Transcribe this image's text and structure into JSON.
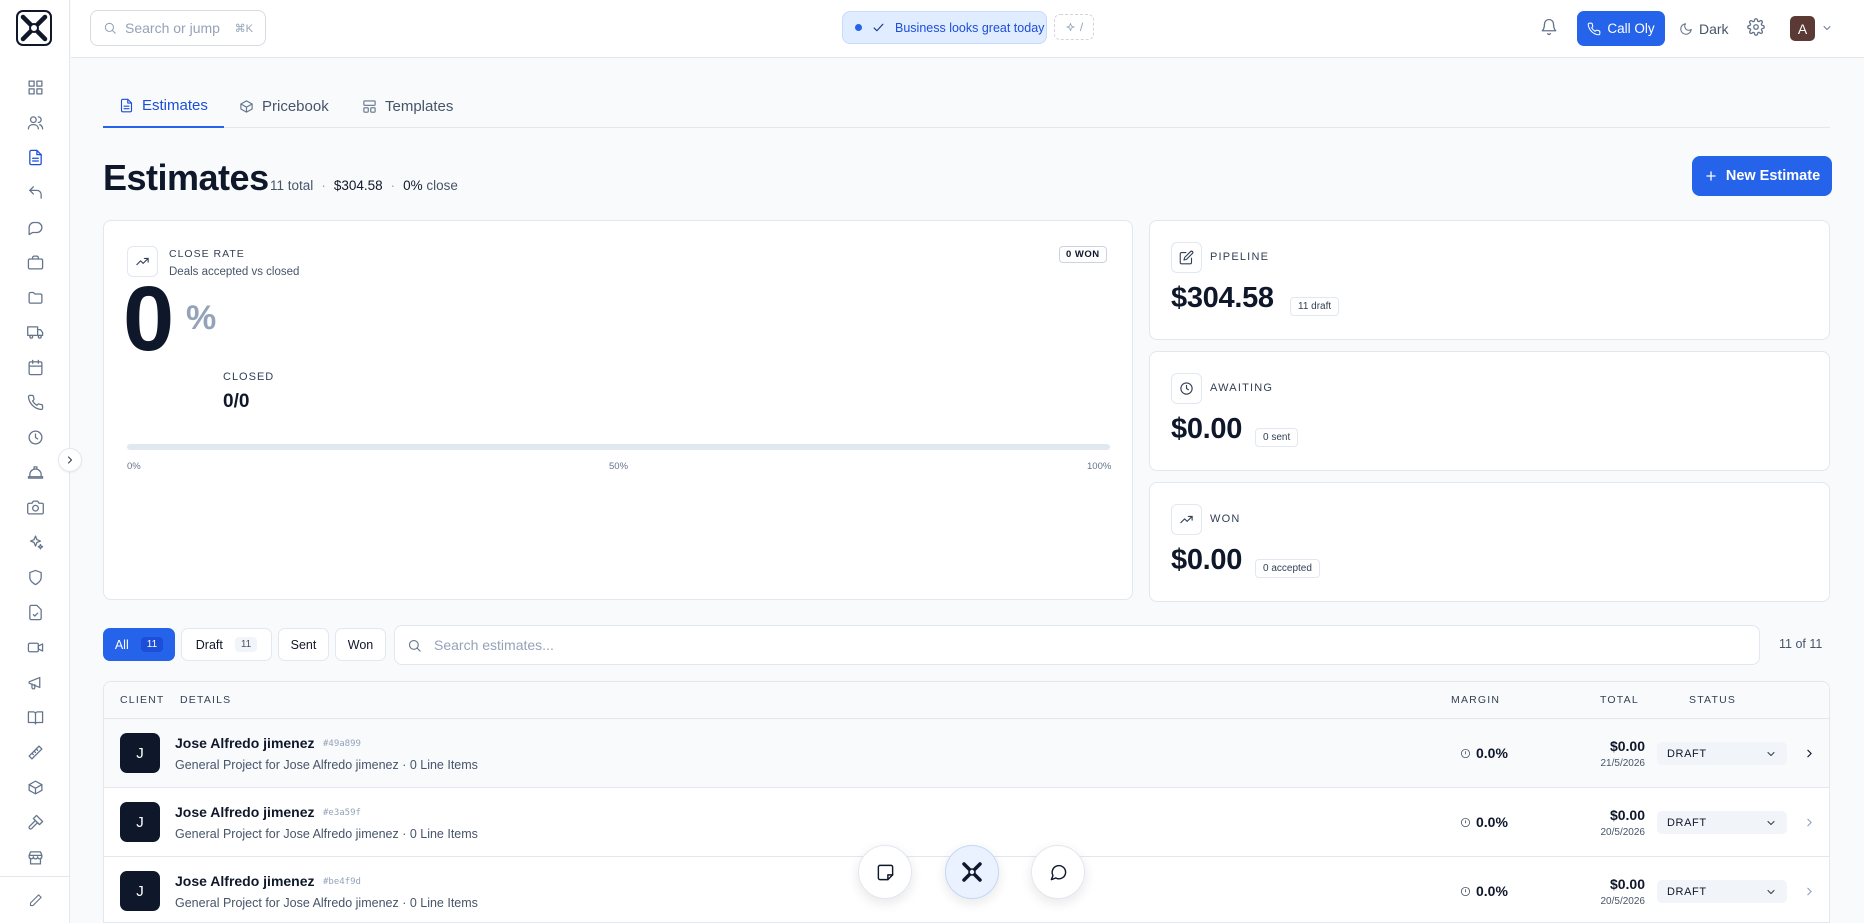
{
  "topbar": {
    "search_placeholder": "Search or jump",
    "search_kbd": "⌘K",
    "status_text": "Business looks great today",
    "slash_hint": "/",
    "call_label": "Call Oly",
    "theme_label": "Dark",
    "avatar_initial": "A"
  },
  "tabs": [
    {
      "label": "Estimates",
      "icon": "file-text-icon",
      "active": true
    },
    {
      "label": "Pricebook",
      "icon": "box-icon",
      "active": false
    },
    {
      "label": "Templates",
      "icon": "layout-icon",
      "active": false
    }
  ],
  "header": {
    "title": "Estimates",
    "total_count": "11",
    "total_label": "total",
    "pipeline_amount": "$304.58",
    "close_pct": "0%",
    "close_label": "close",
    "new_button": "New Estimate"
  },
  "close_rate": {
    "label": "CLOSE RATE",
    "subtitle": "Deals accepted vs closed",
    "won_badge": "0 WON",
    "value": "0",
    "unit": "%",
    "closed_label": "CLOSED",
    "closed_value": "0/0",
    "progress_percent": 0,
    "ticks": [
      "0%",
      "50%",
      "100%"
    ]
  },
  "metrics": [
    {
      "label": "PIPELINE",
      "value": "$304.58",
      "badge": "11 draft",
      "icon": "edit-icon"
    },
    {
      "label": "AWAITING",
      "value": "$0.00",
      "badge": "0 sent",
      "icon": "clock-icon"
    },
    {
      "label": "WON",
      "value": "$0.00",
      "badge": "0 accepted",
      "icon": "trending-up-icon"
    }
  ],
  "filters": {
    "chips": [
      {
        "label": "All",
        "count": "11",
        "active": true
      },
      {
        "label": "Draft",
        "count": "11",
        "active": false
      },
      {
        "label": "Sent",
        "count": "",
        "active": false
      },
      {
        "label": "Won",
        "count": "",
        "active": false
      }
    ],
    "search_placeholder": "Search estimates...",
    "result_count": "11 of 11"
  },
  "table": {
    "columns": {
      "client": "CLIENT",
      "details": "DETAILS",
      "margin": "MARGIN",
      "total": "TOTAL",
      "status": "STATUS"
    },
    "rows": [
      {
        "initial": "J",
        "name": "Jose Alfredo jimenez",
        "hash": "#49a899",
        "description": "General Project for Jose Alfredo jimenez · 0 Line Items",
        "margin": "0.0%",
        "total": "$0.00",
        "date": "21/5/2026",
        "status": "DRAFT"
      },
      {
        "initial": "J",
        "name": "Jose Alfredo jimenez",
        "hash": "#e3a59f",
        "description": "General Project for Jose Alfredo jimenez · 0 Line Items",
        "margin": "0.0%",
        "total": "$0.00",
        "date": "20/5/2026",
        "status": "DRAFT"
      },
      {
        "initial": "J",
        "name": "Jose Alfredo jimenez",
        "hash": "#be4f9d",
        "description": "General Project for Jose Alfredo jimenez · 0 Line Items",
        "margin": "0.0%",
        "total": "$0.00",
        "date": "20/5/2026",
        "status": "DRAFT"
      }
    ]
  },
  "colors": {
    "accent": "#2563eb",
    "text": "#0f172a",
    "muted": "#475569",
    "border": "#e2e8f0"
  }
}
